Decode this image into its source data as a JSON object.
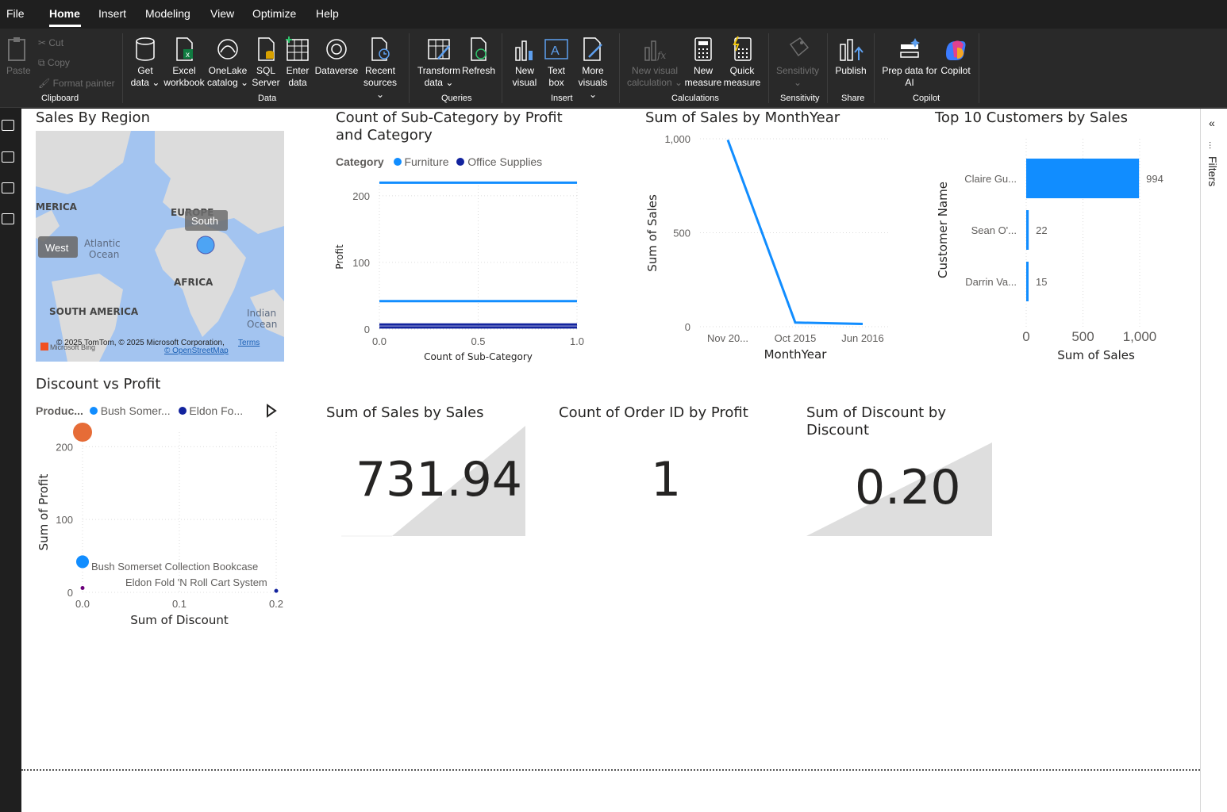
{
  "menu": {
    "items": [
      "File",
      "Home",
      "Insert",
      "Modeling",
      "View",
      "Optimize",
      "Help"
    ],
    "active": "Home"
  },
  "ribbon": {
    "clipboard": {
      "paste": "Paste",
      "cut": "Cut",
      "copy": "Copy",
      "format_painter": "Format painter",
      "group": "Clipboard"
    },
    "data": {
      "get_data": [
        "Get",
        "data"
      ],
      "excel": [
        "Excel",
        "workbook"
      ],
      "onelake": [
        "OneLake",
        "catalog"
      ],
      "sql": [
        "SQL",
        "Server"
      ],
      "enter": [
        "Enter",
        "data"
      ],
      "dataverse": "Dataverse",
      "recent": [
        "Recent",
        "sources"
      ],
      "group": "Data"
    },
    "queries": {
      "transform": [
        "Transform",
        "data"
      ],
      "refresh": "Refresh",
      "group": "Queries"
    },
    "insert": {
      "new_visual": [
        "New",
        "visual"
      ],
      "text_box": [
        "Text",
        "box"
      ],
      "more_visuals": [
        "More",
        "visuals"
      ],
      "group": "Insert"
    },
    "calculations": {
      "new_visual_calc": [
        "New visual",
        "calculation"
      ],
      "new_measure": [
        "New",
        "measure"
      ],
      "quick_measure": [
        "Quick",
        "measure"
      ],
      "group": "Calculations"
    },
    "sensitivity": {
      "label": "Sensitivity",
      "group": "Sensitivity"
    },
    "share": {
      "publish": "Publish",
      "group": "Share"
    },
    "copilot": {
      "prep": [
        "Prep data for",
        "AI"
      ],
      "copilot": "Copilot",
      "group": "Copilot"
    }
  },
  "filters_pane": {
    "label": "Filters"
  },
  "visuals": {
    "map": {
      "title": "Sales By Region",
      "labels": {
        "america": "MERICA",
        "europe": "EUROPE",
        "south_label": "South",
        "west": "West",
        "atlantic": "Atlantic",
        "ocean": "Ocean",
        "africa": "AFRICA",
        "south_america": "SOUTH AMERICA",
        "indian": "Indian",
        "indian_ocean": "Ocean"
      },
      "copyright": "© 2025 TomTom, © 2025 Microsoft Corporation,",
      "terms": "Terms",
      "osm": "© OpenStreetMap",
      "bing": "Microsoft Bing"
    },
    "subcat": {
      "title_line1": "Count of Sub-Category by Profit",
      "title_line2": "and Category",
      "legend_title": "Category",
      "legend": [
        {
          "name": "Furniture",
          "color": "#118dff"
        },
        {
          "name": "Office Supplies",
          "color": "#12239e"
        }
      ],
      "xlabel": "Count of Sub-Category",
      "ylabel": "Profit",
      "xticks": [
        "0.0",
        "0.5",
        "1.0"
      ],
      "yticks": [
        "0",
        "100",
        "200"
      ]
    },
    "monthyear": {
      "title": "Sum of Sales by MonthYear",
      "xlabel": "MonthYear",
      "ylabel": "Sum of Sales",
      "xticks": [
        "Nov 20...",
        "Oct 2015",
        "Jun 2016"
      ],
      "yticks": [
        "0",
        "500",
        "1,000"
      ]
    },
    "top10": {
      "title": "Top 10 Customers by Sales",
      "xlabel": "Sum of Sales",
      "ylabel": "Customer Name",
      "xticks": [
        "0",
        "500",
        "1,000"
      ]
    },
    "discount": {
      "title": "Discount vs Profit",
      "legend_title": "Produc...",
      "legend": [
        {
          "name": "Bush Somer...",
          "color": "#118dff"
        },
        {
          "name": "Eldon Fo...",
          "color": "#12239e"
        }
      ],
      "xlabel": "Sum of Discount",
      "ylabel": "Sum of Profit",
      "xticks": [
        "0.0",
        "0.1",
        "0.2"
      ],
      "yticks": [
        "0",
        "100",
        "200"
      ],
      "point_labels": [
        "Bush Somerset Collection Bookcase",
        "Eldon Fold 'N Roll Cart System"
      ]
    },
    "card_sales": {
      "title": "Sum of Sales by Sales",
      "value": "731.94"
    },
    "card_orders": {
      "title": "Count of Order ID by Profit",
      "value": "1"
    },
    "card_discount": {
      "title_line1": "Sum of Discount by",
      "title_line2": "Discount",
      "value": "0.20"
    }
  },
  "chart_data": [
    {
      "type": "line",
      "title": "Count of Sub-Category by Profit and Category",
      "xlabel": "Count of Sub-Category",
      "ylabel": "Profit",
      "xlim": [
        0,
        1
      ],
      "ylim": [
        0,
        220
      ],
      "series": [
        {
          "name": "Furniture",
          "color": "#118dff",
          "x": [
            0,
            1
          ],
          "y": [
            219.58,
            219.58
          ]
        },
        {
          "name": "Furniture",
          "color": "#118dff",
          "x": [
            0,
            1
          ],
          "y": [
            41.91,
            41.91
          ]
        },
        {
          "name": "Office Supplies",
          "color": "#12239e",
          "x": [
            0,
            1
          ],
          "y": [
            6.87,
            6.87
          ]
        },
        {
          "name": "Office Supplies",
          "color": "#12239e",
          "x": [
            0,
            1
          ],
          "y": [
            2.5,
            2.5
          ]
        }
      ]
    },
    {
      "type": "line",
      "title": "Sum of Sales by MonthYear",
      "xlabel": "MonthYear",
      "ylabel": "Sum of Sales",
      "categories": [
        "Nov 20...",
        "Oct 2015",
        "Jun 2016"
      ],
      "values": [
        994,
        22,
        15
      ],
      "ylim": [
        0,
        1000
      ]
    },
    {
      "type": "bar",
      "orientation": "horizontal",
      "title": "Top 10 Customers by Sales",
      "xlabel": "Sum of Sales",
      "ylabel": "Customer Name",
      "categories": [
        "Claire Gu...",
        "Sean O'...",
        "Darrin Va..."
      ],
      "values": [
        994,
        22,
        15
      ],
      "xlim": [
        0,
        1000
      ]
    },
    {
      "type": "scatter",
      "title": "Discount vs Profit",
      "xlabel": "Sum of Discount",
      "ylabel": "Sum of Profit",
      "xlim": [
        0,
        0.2
      ],
      "ylim": [
        0,
        220
      ],
      "points": [
        {
          "x": 0.0,
          "y": 220,
          "color": "#e66c37"
        },
        {
          "x": 0.0,
          "y": 42,
          "color": "#118dff",
          "label": "Bush Somerset Collection Bookcase"
        },
        {
          "x": 0.0,
          "y": 6,
          "color": "#6b007b",
          "label": "Eldon Fold 'N Roll Cart System"
        },
        {
          "x": 0.2,
          "y": 2,
          "color": "#12239e"
        }
      ]
    }
  ]
}
